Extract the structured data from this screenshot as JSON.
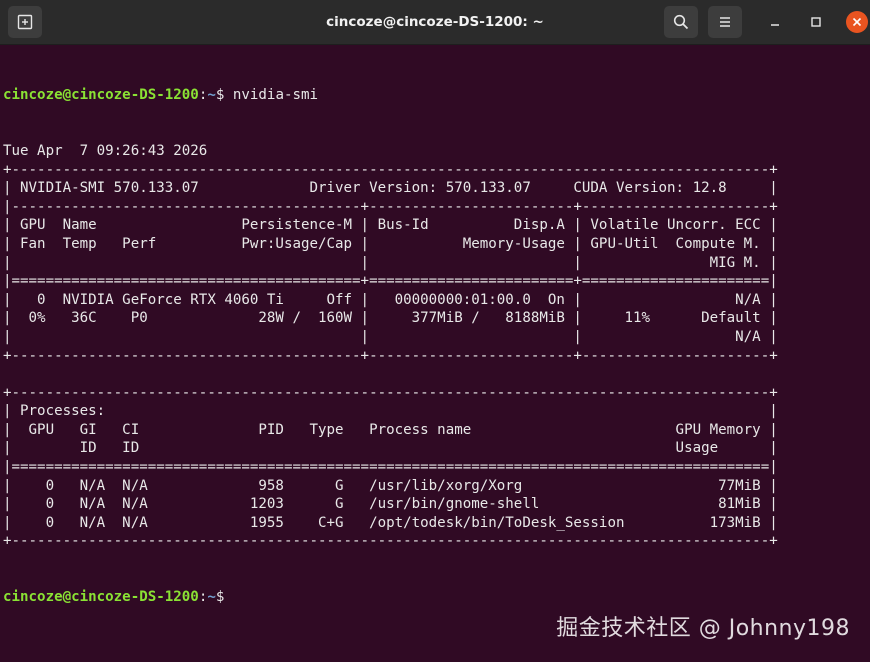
{
  "window": {
    "title": "cincoze@cincoze-DS-1200: ~"
  },
  "icons": {
    "new_tab": "new-tab-icon",
    "search": "search-icon",
    "menu": "hamburger-menu-icon",
    "minimize": "minimize-icon",
    "maximize": "maximize-icon",
    "close": "close-icon"
  },
  "colors": {
    "terminal_bg": "#300a24",
    "titlebar_bg": "#2b2b2b",
    "prompt_user": "#8ae234",
    "prompt_path": "#729fcf",
    "close_button": "#e95420"
  },
  "terminal": {
    "prompt_user": "cincoze@cincoze-DS-1200",
    "prompt_sep": ":",
    "prompt_path": "~",
    "prompt_symbol": "$ ",
    "command": "nvidia-smi",
    "output_lines": [
      "Tue Apr  7 09:26:43 2026",
      "+-----------------------------------------------------------------------------------------+",
      "| NVIDIA-SMI 570.133.07             Driver Version: 570.133.07     CUDA Version: 12.8     |",
      "|-----------------------------------------+------------------------+----------------------+",
      "| GPU  Name                 Persistence-M | Bus-Id          Disp.A | Volatile Uncorr. ECC |",
      "| Fan  Temp   Perf          Pwr:Usage/Cap |           Memory-Usage | GPU-Util  Compute M. |",
      "|                                         |                        |               MIG M. |",
      "|=========================================+========================+======================|",
      "|   0  NVIDIA GeForce RTX 4060 Ti     Off |   00000000:01:00.0  On |                  N/A |",
      "|  0%   36C    P0             28W /  160W |     377MiB /   8188MiB |     11%      Default |",
      "|                                         |                        |                  N/A |",
      "+-----------------------------------------+------------------------+----------------------+",
      "",
      "+-----------------------------------------------------------------------------------------+",
      "| Processes:                                                                              |",
      "|  GPU   GI   CI              PID   Type   Process name                        GPU Memory |",
      "|        ID   ID                                                               Usage      |",
      "|=========================================================================================|",
      "|    0   N/A  N/A             958      G   /usr/lib/xorg/Xorg                       77MiB |",
      "|    0   N/A  N/A            1203      G   /usr/bin/gnome-shell                     81MiB |",
      "|    0   N/A  N/A            1955    C+G   /opt/todesk/bin/ToDesk_Session          173MiB |",
      "+-----------------------------------------------------------------------------------------+"
    ]
  },
  "watermark": "掘金技术社区 @ Johnny198"
}
